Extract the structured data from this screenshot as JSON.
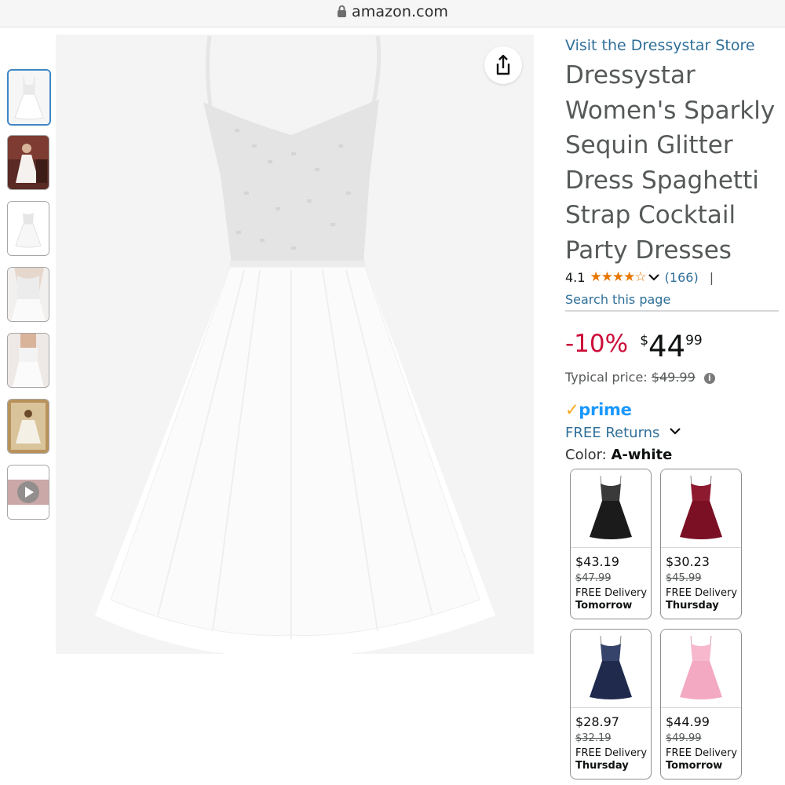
{
  "browser": {
    "url": "amazon.com"
  },
  "gallery": {
    "thumbnails": [
      {
        "label": "",
        "type": "image"
      },
      {
        "label": "",
        "type": "image"
      },
      {
        "label": "",
        "type": "image"
      },
      {
        "label": "",
        "type": "image"
      },
      {
        "label": "",
        "type": "image"
      },
      {
        "label": "",
        "type": "image"
      },
      {
        "label": "",
        "type": "video"
      }
    ]
  },
  "product": {
    "store_link": "Visit the Dressystar Store",
    "title_lines": [
      "Dressystar",
      "Women's Sparkly",
      "Sequin Glitter",
      "Dress Spaghetti",
      "Strap Cocktail",
      "Party Dresses"
    ],
    "rating": "4.1",
    "stars": "★★★★☆",
    "review_count": "(166)",
    "separator": "|",
    "search_page": "Search this page",
    "discount": "-10%",
    "price_symbol": "$",
    "price_whole": "44",
    "price_fraction": "99",
    "typical_label": "Typical price:",
    "typical_price": "$49.99",
    "prime_label": "prime",
    "free_returns": "FREE Returns",
    "color_label": "Color:",
    "color_value": "A-white"
  },
  "swatches": [
    {
      "price": "$43.19",
      "old_price": "$47.99",
      "delivery": "FREE Delivery",
      "day": "Tomorrow",
      "color": "#1b1b1b"
    },
    {
      "price": "$30.23",
      "old_price": "$45.99",
      "delivery": "FREE Delivery",
      "day": "Thursday",
      "color": "#7b0f24"
    },
    {
      "price": "$28.97",
      "old_price": "$32.19",
      "delivery": "FREE Delivery",
      "day": "Thursday",
      "color": "#1f2a4d"
    },
    {
      "price": "$44.99",
      "old_price": "$49.99",
      "delivery": "FREE Delivery",
      "day": "Tomorrow",
      "color": "#f4a9c3"
    }
  ],
  "colors": {
    "link": "#2f6f99",
    "discount": "#cc0c39",
    "star": "#e77600",
    "prime": "#1a98ff",
    "selected_thumb": "#3f86c5"
  },
  "icons": [
    "lock-icon",
    "share-icon",
    "chevron-down-icon",
    "info-icon",
    "play-icon"
  ]
}
